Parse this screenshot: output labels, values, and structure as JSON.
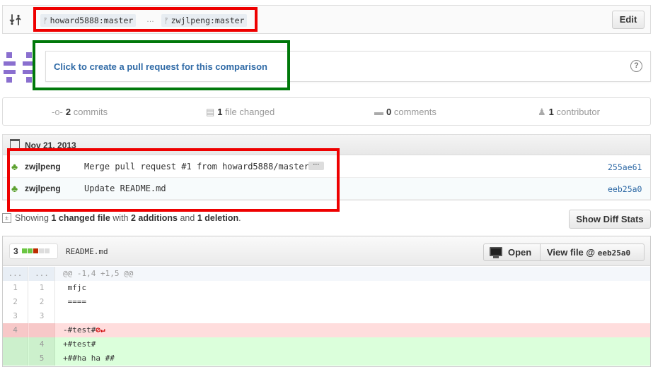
{
  "compare": {
    "base_branch": "howard5888:master",
    "separator": "…",
    "head_branch": "zwjlpeng:master",
    "edit_label": "Edit"
  },
  "pull_request": {
    "link_text": "Click to create a pull request for this comparison",
    "help_glyph": "?"
  },
  "stats": {
    "commits_count": "2",
    "commits_label": "commits",
    "files_count": "1",
    "files_label": "file changed",
    "comments_count": "0",
    "comments_label": "comments",
    "contributors_count": "1",
    "contributors_label": "contributor"
  },
  "commits": {
    "date": "Nov 21, 2013",
    "items": [
      {
        "author": "zwjlpeng",
        "message": "Merge pull request #1 from howard5888/master",
        "sha": "255ae61"
      },
      {
        "author": "zwjlpeng",
        "message": "Update README.md",
        "sha": "eeb25a0"
      }
    ]
  },
  "summary": {
    "prefix": "Showing",
    "files": "1 changed file",
    "with": "with",
    "additions": "2 additions",
    "and": "and",
    "deletions": "1 deletion",
    "suffix": ".",
    "show_diff_stats_label": "Show Diff Stats"
  },
  "file": {
    "changes": "3",
    "diffstat_blocks": [
      "add",
      "add",
      "del",
      "neutral",
      "neutral"
    ],
    "name": "README.md",
    "open_label": "Open",
    "view_file_label": "View file @",
    "view_file_sha": "eeb25a0"
  },
  "diff": [
    {
      "type": "hunk",
      "old": "...",
      "new": "...",
      "code": "@@ -1,4 +1,5 @@"
    },
    {
      "type": "context",
      "old": "1",
      "new": "1",
      "code": " mfjc"
    },
    {
      "type": "context",
      "old": "2",
      "new": "2",
      "code": " ===="
    },
    {
      "type": "context",
      "old": "3",
      "new": "3",
      "code": " "
    },
    {
      "type": "del",
      "old": "4",
      "new": "",
      "code": "-#test#",
      "marker": "⊘↵"
    },
    {
      "type": "add",
      "old": "",
      "new": "4",
      "code": "+#test#"
    },
    {
      "type": "add",
      "old": "",
      "new": "5",
      "code": "+##ha ha ##"
    }
  ],
  "colors": {
    "link": "#2f6aa6",
    "annotation_red": "#e00000",
    "annotation_green": "#00780a",
    "diff_add_bg": "#dbffdb",
    "diff_del_bg": "#ffdddd",
    "diffstat_add": "#6cc644",
    "diffstat_del": "#bd2c00"
  },
  "icons": {
    "compare": "compare-arrows-icon",
    "branch": "git-branch-icon",
    "commit": "git-commit-icon",
    "file": "file-diff-icon",
    "comment": "comment-icon",
    "contributor": "organization-icon",
    "calendar": "calendar-icon",
    "monitor": "desktop-icon",
    "help": "question-icon"
  }
}
